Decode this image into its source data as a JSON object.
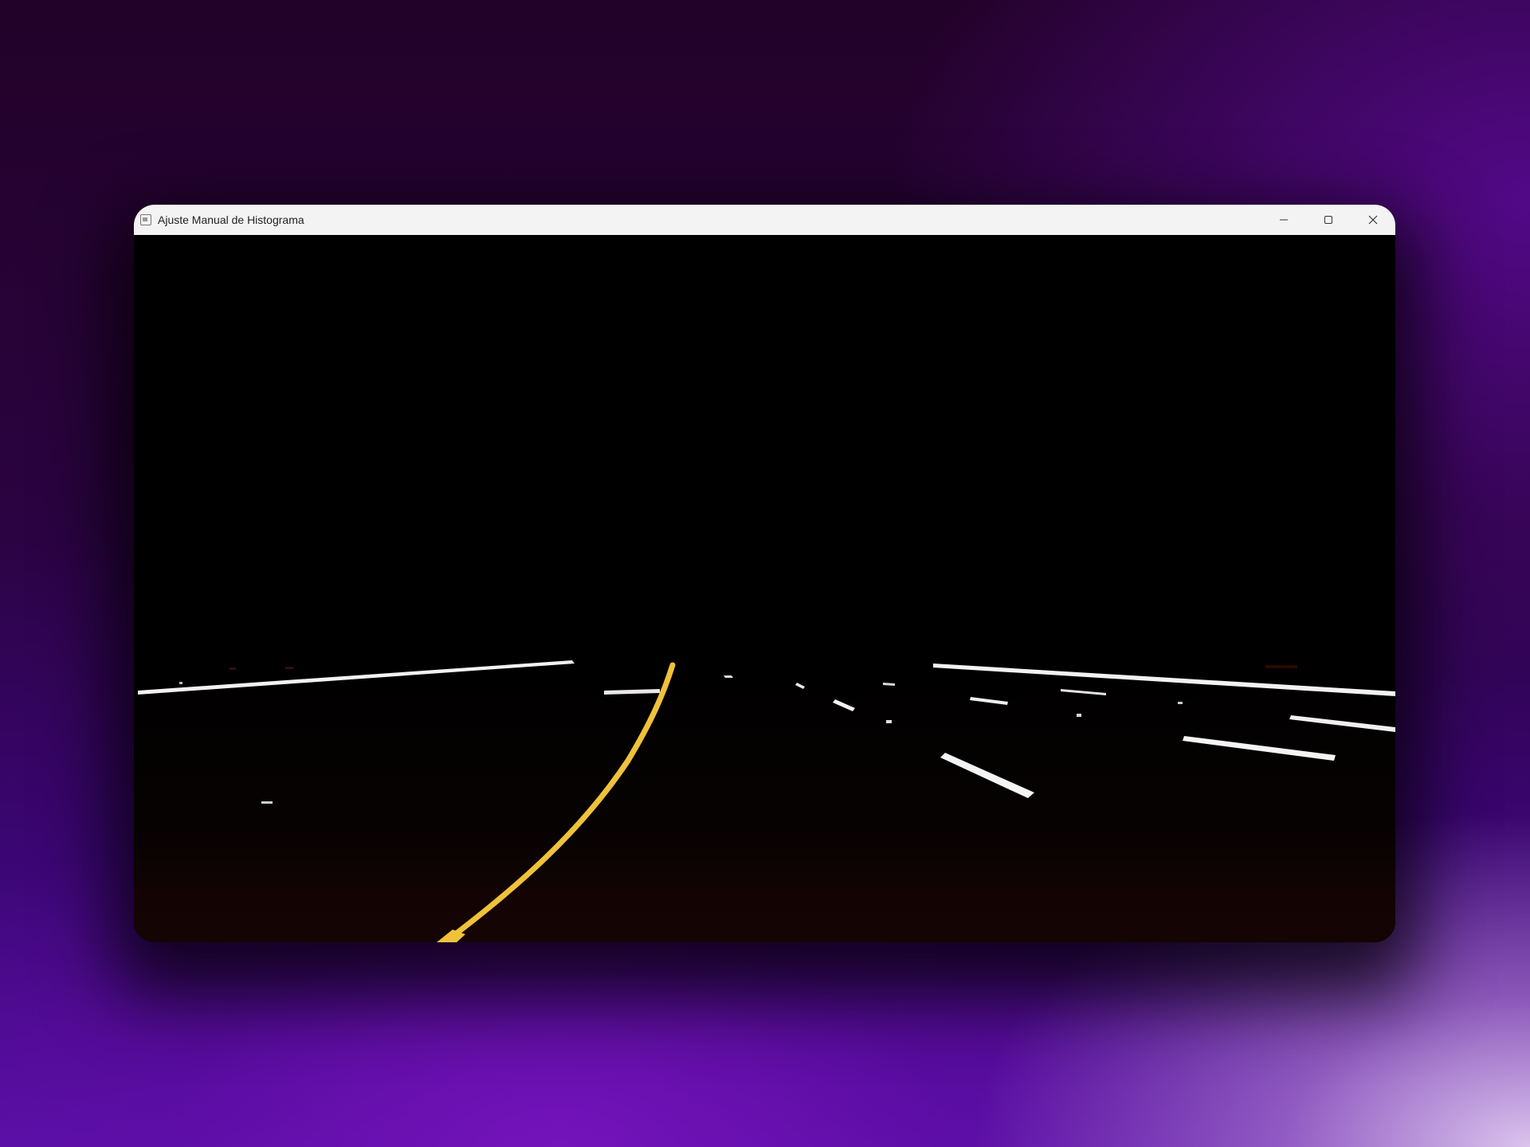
{
  "window": {
    "title": "Ajuste Manual de Histograma",
    "controls": {
      "minimize_icon": "minimize-icon",
      "maximize_icon": "maximize-icon",
      "close_icon": "close-icon"
    }
  },
  "viewport": {
    "content": "road-frame",
    "colors": {
      "background": "#000000",
      "lane_white": "#f2f2f2",
      "lane_yellow": "#f0c23a",
      "road_tint": "#120504"
    }
  }
}
